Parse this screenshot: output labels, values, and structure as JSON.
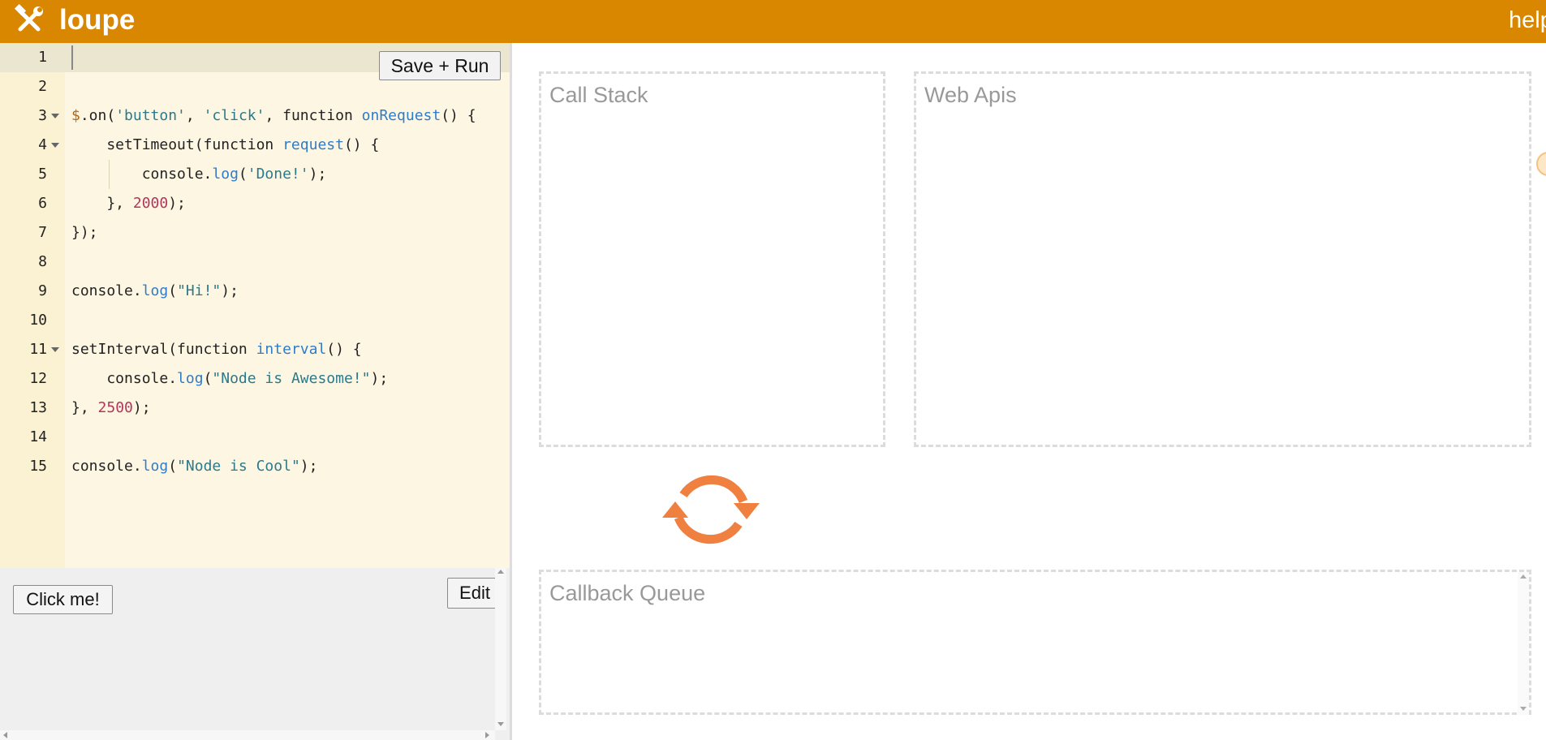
{
  "app": {
    "logo_icon": "hammer-wrench-icon",
    "name": "loupe",
    "help_label": "help",
    "topbar_color": "#d98700"
  },
  "editor": {
    "save_run_label": "Save + Run",
    "lines": [
      {
        "n": "1",
        "tokens": []
      },
      {
        "n": "2",
        "tokens": []
      },
      {
        "n": "3",
        "fold": true,
        "tokens": [
          {
            "t": "$",
            "c": "dollar"
          },
          {
            "t": ".on(",
            "c": "plain"
          },
          {
            "t": "'button'",
            "c": "str"
          },
          {
            "t": ", ",
            "c": "plain"
          },
          {
            "t": "'click'",
            "c": "str"
          },
          {
            "t": ", function ",
            "c": "plain"
          },
          {
            "t": "onRequest",
            "c": "fn"
          },
          {
            "t": "() {",
            "c": "plain"
          }
        ]
      },
      {
        "n": "4",
        "fold": true,
        "tokens": [
          {
            "t": "    setTimeout(function ",
            "c": "plain"
          },
          {
            "t": "request",
            "c": "fn"
          },
          {
            "t": "() {",
            "c": "plain"
          }
        ]
      },
      {
        "n": "5",
        "guide": true,
        "tokens": [
          {
            "t": "        console.",
            "c": "plain"
          },
          {
            "t": "log",
            "c": "fn"
          },
          {
            "t": "(",
            "c": "plain"
          },
          {
            "t": "'Done!'",
            "c": "str"
          },
          {
            "t": ");",
            "c": "plain"
          }
        ]
      },
      {
        "n": "6",
        "tokens": [
          {
            "t": "    }, ",
            "c": "plain"
          },
          {
            "t": "2000",
            "c": "num"
          },
          {
            "t": ");",
            "c": "plain"
          }
        ]
      },
      {
        "n": "7",
        "tokens": [
          {
            "t": "});",
            "c": "plain"
          }
        ]
      },
      {
        "n": "8",
        "tokens": []
      },
      {
        "n": "9",
        "tokens": [
          {
            "t": "console.",
            "c": "plain"
          },
          {
            "t": "log",
            "c": "fn"
          },
          {
            "t": "(",
            "c": "plain"
          },
          {
            "t": "\"Hi!\"",
            "c": "str"
          },
          {
            "t": ");",
            "c": "plain"
          }
        ]
      },
      {
        "n": "10",
        "tokens": []
      },
      {
        "n": "11",
        "fold": true,
        "tokens": [
          {
            "t": "setInterval(function ",
            "c": "plain"
          },
          {
            "t": "interval",
            "c": "fn"
          },
          {
            "t": "() {",
            "c": "plain"
          }
        ]
      },
      {
        "n": "12",
        "tokens": [
          {
            "t": "    console.",
            "c": "plain"
          },
          {
            "t": "log",
            "c": "fn"
          },
          {
            "t": "(",
            "c": "plain"
          },
          {
            "t": "\"Node is Awesome!\"",
            "c": "str"
          },
          {
            "t": ");",
            "c": "plain"
          }
        ]
      },
      {
        "n": "13",
        "tokens": [
          {
            "t": "}, ",
            "c": "plain"
          },
          {
            "t": "2500",
            "c": "num"
          },
          {
            "t": ");",
            "c": "plain"
          }
        ]
      },
      {
        "n": "14",
        "tokens": []
      },
      {
        "n": "15",
        "tokens": [
          {
            "t": "console.",
            "c": "plain"
          },
          {
            "t": "log",
            "c": "fn"
          },
          {
            "t": "(",
            "c": "plain"
          },
          {
            "t": "\"Node is Cool\"",
            "c": "str"
          },
          {
            "t": ");",
            "c": "plain"
          }
        ]
      }
    ]
  },
  "preview": {
    "click_me_label": "Click me!",
    "edit_label": "Edit"
  },
  "visualizer": {
    "call_stack_title": "Call Stack",
    "web_apis_title": "Web Apis",
    "callback_queue_title": "Callback Queue",
    "event_loop_icon": "refresh-cycle-icon",
    "event_loop_color": "#f08040"
  }
}
